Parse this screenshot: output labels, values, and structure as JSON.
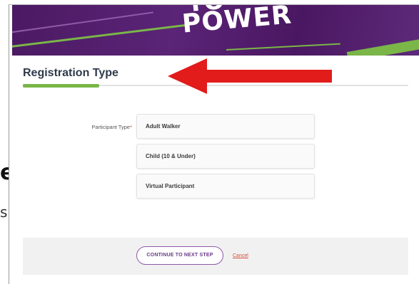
{
  "banner": {
    "title": "POWER",
    "title_top": "TO",
    "accent": "#7ab648",
    "background": "#4b1a63"
  },
  "left_edge": {
    "char1": "e",
    "char2": "s"
  },
  "section": {
    "title": "Registration Type"
  },
  "form": {
    "field_label": "Participant Type",
    "required_mark": "*",
    "options": [
      {
        "label": "Adult Walker"
      },
      {
        "label": "Child (10 & Under)"
      },
      {
        "label": "Virtual Participant"
      }
    ]
  },
  "footer": {
    "continue_label": "CONTINUE TO NEXT STEP",
    "cancel_label": "Cancel"
  },
  "annotation": {
    "arrow_color": "#e21b1b",
    "icon": "red-arrow-left-icon"
  }
}
